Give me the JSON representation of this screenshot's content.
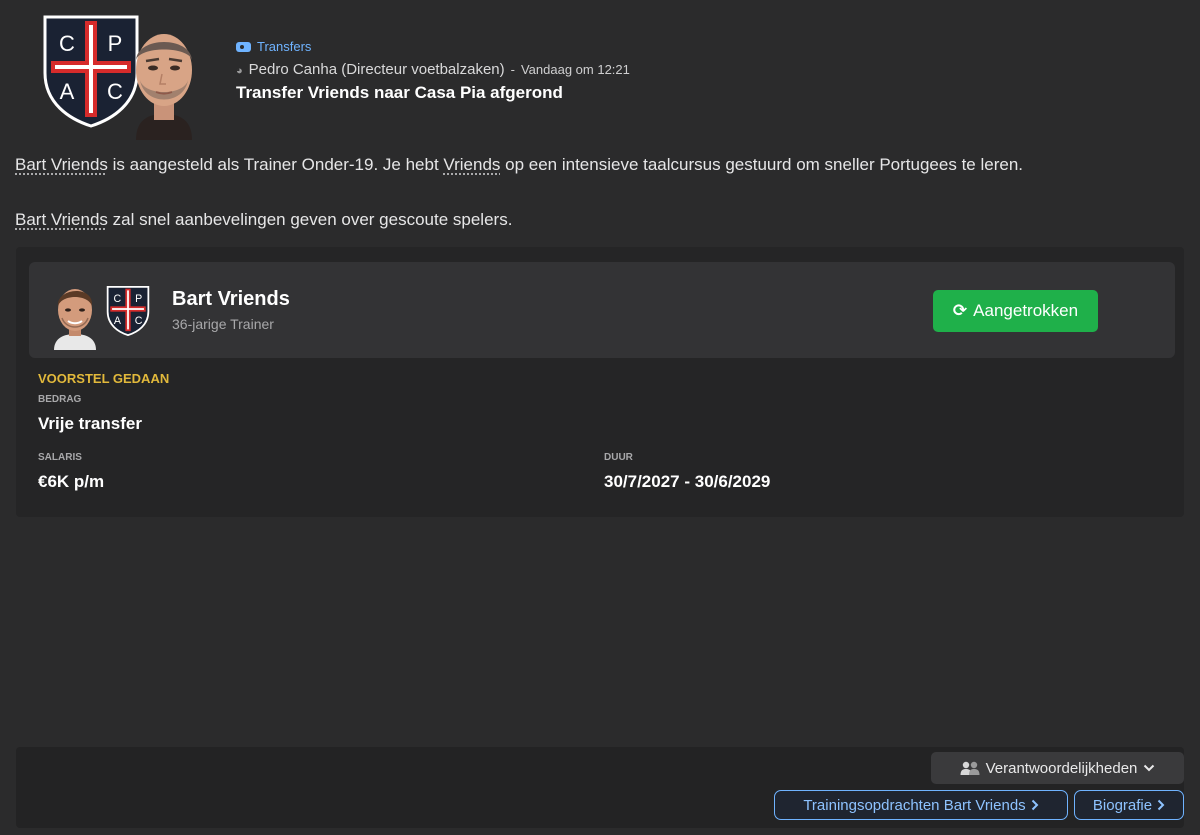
{
  "message": {
    "category": "Transfers",
    "sender": "Pedro Canha (Directeur voetbalzaken)",
    "separator": "-",
    "time": "Vandaag om 12:21",
    "title": "Transfer Vriends naar Casa Pia afgerond",
    "crest_letters": [
      "C",
      "P",
      "A",
      "C"
    ]
  },
  "body": {
    "p1_name": "Bart Vriends",
    "p1_text_a": " is aangesteld als Trainer Onder-19. Je hebt ",
    "p1_name2": "Vriends",
    "p1_text_b": " op een intensieve taalcursus gestuurd om sneller Portugees te leren.",
    "p2_name": "Bart Vriends",
    "p2_text": " zal snel aanbevelingen geven over gescoute spelers."
  },
  "person": {
    "name": "Bart Vriends",
    "subtitle": "36-jarige Trainer",
    "status": "Aangetrokken"
  },
  "offer": {
    "heading": "VOORSTEL GEDAAN",
    "amount_label": "BEDRAG",
    "amount_value": "Vrije transfer",
    "salary_label": "SALARIS",
    "salary_value": "€6K p/m",
    "duration_label": "DUUR",
    "duration_value": "30/7/2027 - 30/6/2029"
  },
  "footer": {
    "responsibilities": "Verantwoordelijkheden",
    "training_link": "Trainingsopdrachten Bart Vriends",
    "bio_link": "Biografie"
  },
  "colors": {
    "background": "#2b2b2c",
    "accent_link": "#6fb3ff",
    "status_green": "#1fb04a",
    "heading_gold": "#e2b93b",
    "crest_red": "#d62b2b",
    "crest_navy": "#1a2233"
  },
  "icons": [
    "tag-icon",
    "person-icon",
    "refresh-icon",
    "people-icon",
    "chevron-down-icon",
    "chevron-right-icon"
  ]
}
